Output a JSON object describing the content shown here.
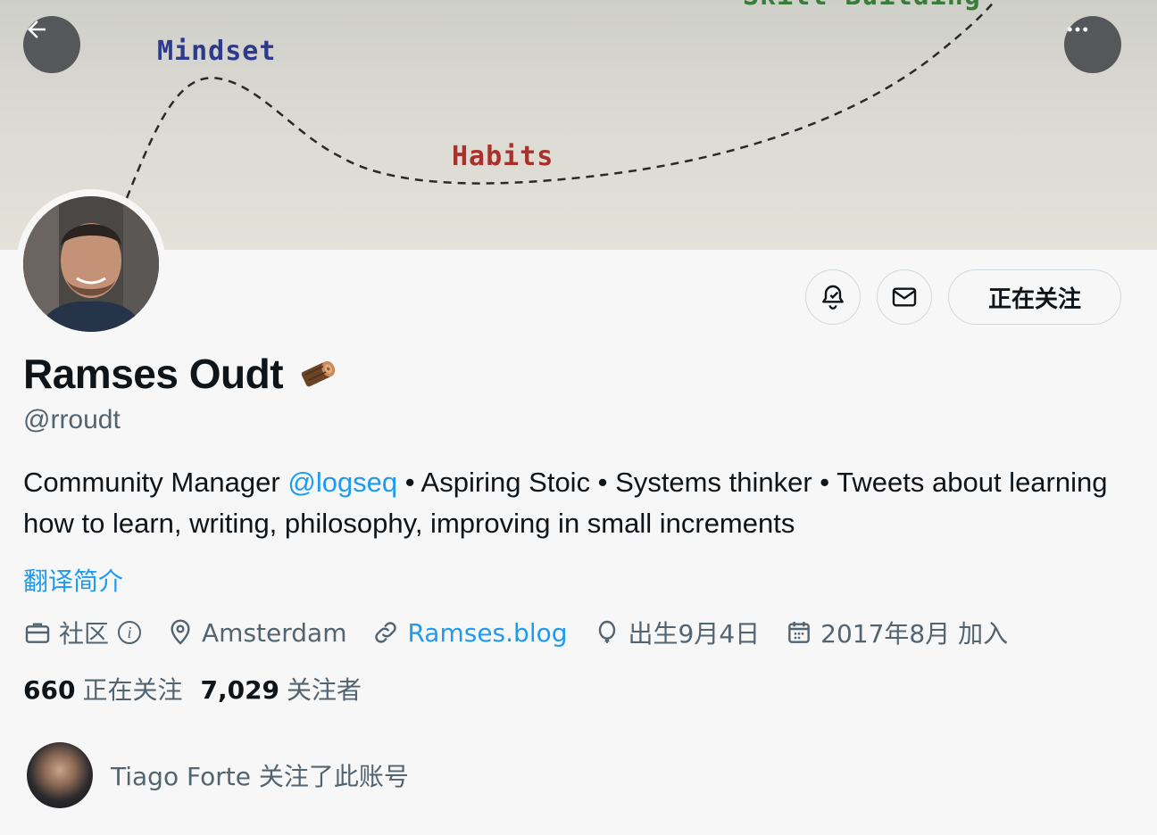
{
  "banner": {
    "labels": {
      "mindset": "Mindset",
      "habits": "Habits",
      "skill": "Skill Building"
    }
  },
  "profile": {
    "display_name": "Ramses Oudt",
    "handle": "@rroudt",
    "bio_part1": "Community Manager ",
    "bio_mention": "@logseq",
    "bio_part2": " • Aspiring Stoic • Systems thinker • Tweets about learning how to learn, writing, philosophy, improving in small increments",
    "translate_label": "翻译简介"
  },
  "actions": {
    "follow_label": "正在关注"
  },
  "meta": {
    "category": "社区",
    "location": "Amsterdam",
    "website": "Ramses.blog",
    "birthday": "出生9月4日",
    "joined": "2017年8月 加入"
  },
  "stats": {
    "following_count": "660",
    "following_label": "正在关注",
    "followers_count": "7,029",
    "followers_label": "关注者"
  },
  "followed_by": {
    "text": "Tiago Forte 关注了此账号"
  },
  "colors": {
    "accent": "#1d9bf0",
    "muted": "#536471",
    "text": "#0f1419"
  },
  "icons": [
    "back-arrow-icon",
    "more-icon",
    "notification-bell-icon",
    "mail-icon",
    "briefcase-icon",
    "location-pin-icon",
    "link-icon",
    "balloon-icon",
    "calendar-icon",
    "info-icon",
    "wood-log-emoji"
  ]
}
